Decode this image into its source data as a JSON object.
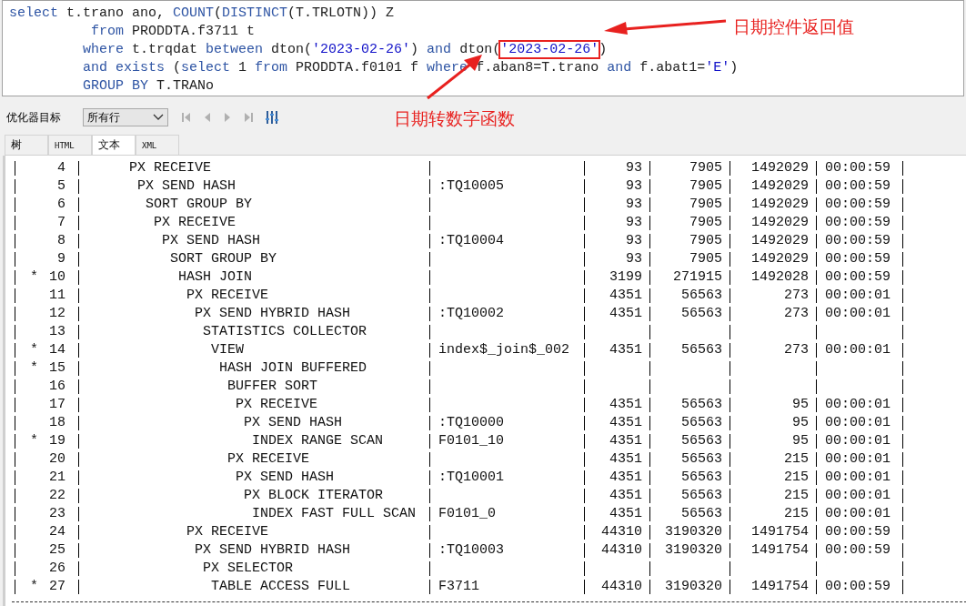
{
  "sql_lines": [
    {
      "tokens": [
        {
          "kind": "keyword",
          "text": "select"
        },
        {
          "kind": "plain",
          "text": " t.trano ano, "
        },
        {
          "kind": "keyword",
          "text": "COUNT"
        },
        {
          "kind": "plain",
          "text": "("
        },
        {
          "kind": "keyword",
          "text": "DISTINCT"
        },
        {
          "kind": "plain",
          "text": "(T.TRLOTN)) Z"
        }
      ]
    },
    {
      "tokens": [
        {
          "kind": "keyword",
          "text": "from"
        },
        {
          "kind": "plain",
          "text": " PRODDTA.f3711 t"
        }
      ]
    },
    {
      "tokens": [
        {
          "kind": "keyword",
          "text": "where"
        },
        {
          "kind": "plain",
          "text": " t.trqdat "
        },
        {
          "kind": "keyword",
          "text": "between"
        },
        {
          "kind": "plain",
          "text": " dton("
        },
        {
          "kind": "string",
          "text": "'2023-02-26'",
          "highlighted": false
        },
        {
          "kind": "plain",
          "text": ") "
        },
        {
          "kind": "keyword",
          "text": "and"
        },
        {
          "kind": "plain",
          "text": " dton("
        },
        {
          "kind": "string",
          "text": "'2023-02-26'",
          "highlighted": true
        },
        {
          "kind": "plain",
          "text": ")"
        }
      ]
    },
    {
      "tokens": [
        {
          "kind": "keyword",
          "text": "and exists"
        },
        {
          "kind": "plain",
          "text": " ("
        },
        {
          "kind": "keyword",
          "text": "select"
        },
        {
          "kind": "plain",
          "text": " 1 "
        },
        {
          "kind": "keyword",
          "text": "from"
        },
        {
          "kind": "plain",
          "text": " PRODDTA.f0101 f "
        },
        {
          "kind": "keyword",
          "text": "where"
        },
        {
          "kind": "plain",
          "text": " f.aban8=T.trano "
        },
        {
          "kind": "keyword",
          "text": "and"
        },
        {
          "kind": "plain",
          "text": " f.abat1="
        },
        {
          "kind": "string",
          "text": "'E'"
        },
        {
          "kind": "plain",
          "text": ")"
        }
      ]
    },
    {
      "tokens": [
        {
          "kind": "keyword",
          "text": "GROUP BY"
        },
        {
          "kind": "plain",
          "text": " T.TRANo"
        }
      ]
    }
  ],
  "annotations": [
    {
      "text": "日期控件返回值"
    },
    {
      "text": "日期转数字函数"
    }
  ],
  "toolbar": {
    "label": "优化器目标",
    "select_value": "所有行"
  },
  "tabs": [
    {
      "label": "树",
      "selected": false
    },
    {
      "label": "HTML",
      "selected": false
    },
    {
      "label": "文本",
      "selected": true
    },
    {
      "label": "XML",
      "selected": false
    }
  ],
  "plan": [
    {
      "id": "4",
      "operation": "PX RECEIVE",
      "column_5": "93",
      "column_6": "7905",
      "column_7": "1492029",
      "column_8": "00:00:59",
      "children": [
        {
          "id": "5",
          "operation": "PX SEND HASH",
          "column_4": ":TQ10005",
          "column_5": "93",
          "column_6": "7905",
          "column_7": "1492029",
          "column_8": "00:00:59",
          "children": [
            {
              "id": "6",
              "operation": "SORT GROUP BY",
              "column_5": "93",
              "column_6": "7905",
              "column_7": "1492029",
              "column_8": "00:00:59",
              "children": [
                {
                  "id": "7",
                  "operation": "PX RECEIVE",
                  "column_5": "93",
                  "column_6": "7905",
                  "column_7": "1492029",
                  "column_8": "00:00:59",
                  "children": [
                    {
                      "id": "8",
                      "operation": "PX SEND HASH",
                      "column_4": ":TQ10004",
                      "column_5": "93",
                      "column_6": "7905",
                      "column_7": "1492029",
                      "column_8": "00:00:59",
                      "children": [
                        {
                          "id": "9",
                          "operation": "SORT GROUP BY",
                          "column_5": "93",
                          "column_6": "7905",
                          "column_7": "1492029",
                          "column_8": "00:00:59",
                          "children": [
                            {
                              "mark": "*",
                              "id": "10",
                              "operation": "HASH JOIN",
                              "column_5": "3199",
                              "column_6": "271915",
                              "column_7": "1492028",
                              "column_8": "00:00:59",
                              "children": [
                                {
                                  "id": "11",
                                  "operation": "PX RECEIVE",
                                  "column_5": "4351",
                                  "column_6": "56563",
                                  "column_7": "273",
                                  "column_8": "00:00:01",
                                  "children": [
                                    {
                                      "id": "12",
                                      "operation": "PX SEND HYBRID HASH",
                                      "column_4": ":TQ10002",
                                      "column_5": "4351",
                                      "column_6": "56563",
                                      "column_7": "273",
                                      "column_8": "00:00:01",
                                      "children": [
                                        {
                                          "id": "13",
                                          "operation": "STATISTICS COLLECTOR",
                                          "children": [
                                            {
                                              "mark": "*",
                                              "id": "14",
                                              "operation": "VIEW",
                                              "column_4": "index$_join$_002",
                                              "column_5": "4351",
                                              "column_6": "56563",
                                              "column_7": "273",
                                              "column_8": "00:00:01",
                                              "children": [
                                                {
                                                  "mark": "*",
                                                  "id": "15",
                                                  "operation": "HASH JOIN BUFFERED",
                                                  "children": [
                                                    {
                                                      "id": "16",
                                                      "operation": "BUFFER SORT",
                                                      "children": [
                                                        {
                                                          "id": "17",
                                                          "operation": "PX RECEIVE",
                                                          "column_5": "4351",
                                                          "column_6": "56563",
                                                          "column_7": "95",
                                                          "column_8": "00:00:01",
                                                          "children": [
                                                            {
                                                              "id": "18",
                                                              "operation": "PX SEND HASH",
                                                              "column_4": ":TQ10000",
                                                              "column_5": "4351",
                                                              "column_6": "56563",
                                                              "column_7": "95",
                                                              "column_8": "00:00:01",
                                                              "children": [
                                                                {
                                                                  "mark": "*",
                                                                  "id": "19",
                                                                  "operation": "INDEX RANGE SCAN",
                                                                  "column_4": "F0101_10",
                                                                  "column_5": "4351",
                                                                  "column_6": "56563",
                                                                  "column_7": "95",
                                                                  "column_8": "00:00:01"
                                                                }
                                                              ]
                                                            }
                                                          ]
                                                        }
                                                      ]
                                                    },
                                                    {
                                                      "id": "20",
                                                      "operation": "PX RECEIVE",
                                                      "column_5": "4351",
                                                      "column_6": "56563",
                                                      "column_7": "215",
                                                      "column_8": "00:00:01",
                                                      "children": [
                                                        {
                                                          "id": "21",
                                                          "operation": "PX SEND HASH",
                                                          "column_4": ":TQ10001",
                                                          "column_5": "4351",
                                                          "column_6": "56563",
                                                          "column_7": "215",
                                                          "column_8": "00:00:01",
                                                          "children": [
                                                            {
                                                              "id": "22",
                                                              "operation": "PX BLOCK ITERATOR",
                                                              "column_5": "4351",
                                                              "column_6": "56563",
                                                              "column_7": "215",
                                                              "column_8": "00:00:01",
                                                              "children": [
                                                                {
                                                                  "id": "23",
                                                                  "operation": "INDEX FAST FULL SCAN",
                                                                  "column_4": "F0101_0",
                                                                  "column_5": "4351",
                                                                  "column_6": "56563",
                                                                  "column_7": "215",
                                                                  "column_8": "00:00:01"
                                                                }
                                                              ]
                                                            }
                                                          ]
                                                        }
                                                      ]
                                                    }
                                                  ]
                                                }
                                              ]
                                            }
                                          ]
                                        }
                                      ]
                                    }
                                  ]
                                },
                                {
                                  "id": "24",
                                  "operation": "PX RECEIVE",
                                  "column_5": "44310",
                                  "column_6": "3190320",
                                  "column_7": "1491754",
                                  "column_8": "00:00:59",
                                  "children": [
                                    {
                                      "id": "25",
                                      "operation": "PX SEND HYBRID HASH",
                                      "column_4": ":TQ10003",
                                      "column_5": "44310",
                                      "column_6": "3190320",
                                      "column_7": "1491754",
                                      "column_8": "00:00:59",
                                      "children": [
                                        {
                                          "id": "26",
                                          "operation": "PX SELECTOR",
                                          "children": [
                                            {
                                              "mark": "*",
                                              "id": "27",
                                              "operation": "TABLE ACCESS FULL",
                                              "column_4": "F3711",
                                              "column_5": "44310",
                                              "column_6": "3190320",
                                              "column_7": "1491754",
                                              "column_8": "00:00:59"
                                            }
                                          ]
                                        }
                                      ]
                                    }
                                  ]
                                }
                              ]
                            }
                          ]
                        }
                      ]
                    }
                  ]
                }
              ]
            }
          ]
        }
      ]
    }
  ]
}
